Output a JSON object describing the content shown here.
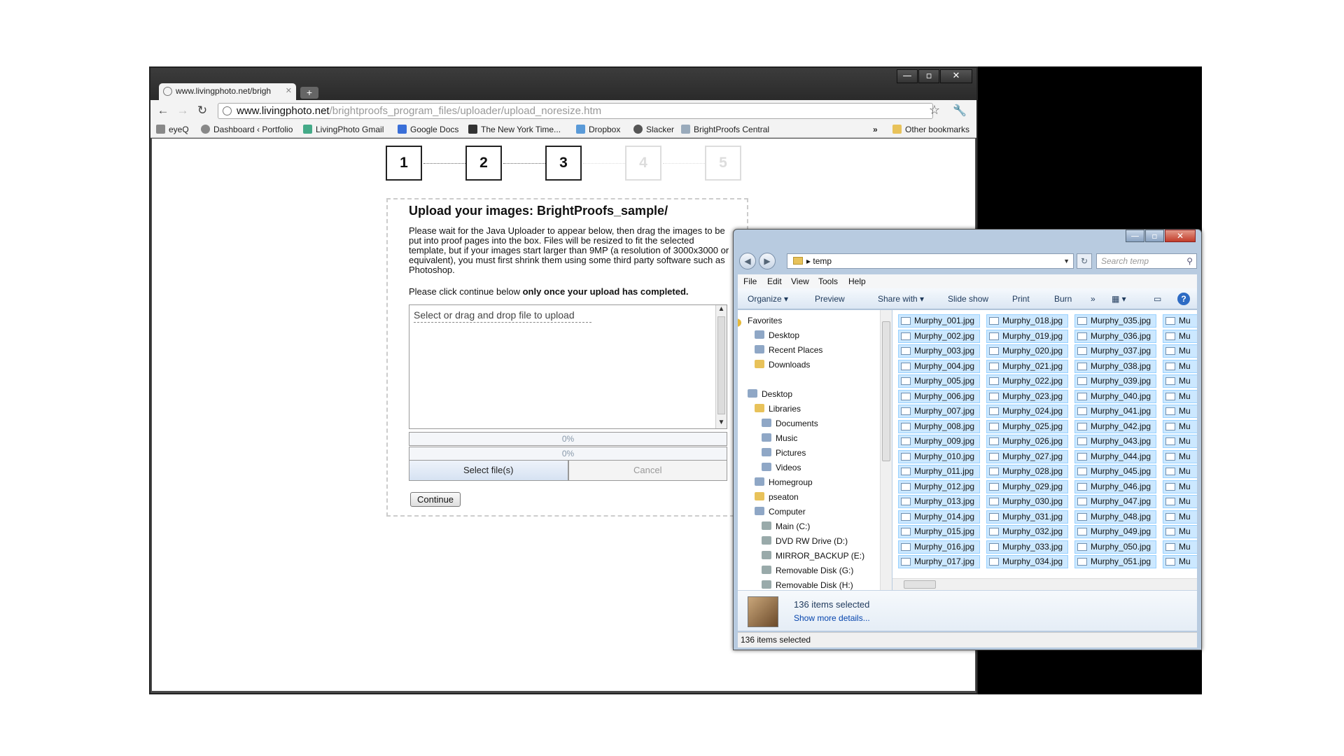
{
  "browser": {
    "tab_title": "www.livingphoto.net/brigh",
    "url_host": "www.livingphoto.net",
    "url_path": "/brightproofs_program_files/uploader/upload_noresize.htm",
    "bookmarks": [
      "eyeQ",
      "Dashboard ‹ Portfolio",
      "LivingPhoto Gmail",
      "Google Docs",
      "The New York Time...",
      "Dropbox",
      "Slacker",
      "BrightProofs Central"
    ],
    "overflow": "»",
    "other_bookmarks": "Other bookmarks"
  },
  "steps": [
    "1",
    "2",
    "3",
    "4",
    "5"
  ],
  "upload": {
    "title": "Upload your images: BrightProofs_sample/",
    "description": "Please wait for the Java Uploader to appear below, then drag the images to be put into proof pages into the box. Files will be resized to fit the selected template, but if your images start larger than 9MP (a resolution of 3000x3000 or equivalent), you must first shrink them using some third party software such as Photoshop.",
    "note_prefix": "Please click continue below ",
    "note_bold": "only once your upload has completed.",
    "drop_text": "Select or drag and drop file to upload",
    "progress1": "0%",
    "progress2": "0%",
    "select_button": "Select file(s)",
    "cancel_button": "Cancel",
    "continue_button": "Continue"
  },
  "explorer": {
    "path": "temp",
    "search_placeholder": "Search temp",
    "menu": [
      "File",
      "Edit",
      "View",
      "Tools",
      "Help"
    ],
    "commands": [
      "Organize ▾",
      "Preview",
      "Share with ▾",
      "Slide show",
      "Print",
      "Burn",
      "»"
    ],
    "nav_items": [
      {
        "label": "Favorites",
        "icon": "star"
      },
      {
        "label": "Desktop",
        "icon": "desktop"
      },
      {
        "label": "Recent Places",
        "icon": "recent"
      },
      {
        "label": "Downloads",
        "icon": "folder"
      },
      {
        "label": "Desktop",
        "icon": "desktop"
      },
      {
        "label": "Libraries",
        "icon": "folder"
      },
      {
        "label": "Documents",
        "icon": "doc"
      },
      {
        "label": "Music",
        "icon": "music"
      },
      {
        "label": "Pictures",
        "icon": "pictures"
      },
      {
        "label": "Videos",
        "icon": "video"
      },
      {
        "label": "Homegroup",
        "icon": "homegroup"
      },
      {
        "label": "pseaton",
        "icon": "folder"
      },
      {
        "label": "Computer",
        "icon": "computer"
      },
      {
        "label": "Main (C:)",
        "icon": "drive"
      },
      {
        "label": "DVD RW Drive (D:)",
        "icon": "drive"
      },
      {
        "label": "MIRROR_BACKUP (E:)",
        "icon": "drive"
      },
      {
        "label": "Removable Disk (G:)",
        "icon": "drive"
      },
      {
        "label": "Removable Disk (H:)",
        "icon": "drive"
      }
    ],
    "files": [
      [
        "Murphy_001.jpg",
        "Murphy_002.jpg",
        "Murphy_003.jpg",
        "Murphy_004.jpg",
        "Murphy_005.jpg",
        "Murphy_006.jpg",
        "Murphy_007.jpg",
        "Murphy_008.jpg",
        "Murphy_009.jpg",
        "Murphy_010.jpg",
        "Murphy_011.jpg",
        "Murphy_012.jpg",
        "Murphy_013.jpg",
        "Murphy_014.jpg",
        "Murphy_015.jpg",
        "Murphy_016.jpg",
        "Murphy_017.jpg"
      ],
      [
        "Murphy_018.jpg",
        "Murphy_019.jpg",
        "Murphy_020.jpg",
        "Murphy_021.jpg",
        "Murphy_022.jpg",
        "Murphy_023.jpg",
        "Murphy_024.jpg",
        "Murphy_025.jpg",
        "Murphy_026.jpg",
        "Murphy_027.jpg",
        "Murphy_028.jpg",
        "Murphy_029.jpg",
        "Murphy_030.jpg",
        "Murphy_031.jpg",
        "Murphy_032.jpg",
        "Murphy_033.jpg",
        "Murphy_034.jpg"
      ],
      [
        "Murphy_035.jpg",
        "Murphy_036.jpg",
        "Murphy_037.jpg",
        "Murphy_038.jpg",
        "Murphy_039.jpg",
        "Murphy_040.jpg",
        "Murphy_041.jpg",
        "Murphy_042.jpg",
        "Murphy_043.jpg",
        "Murphy_044.jpg",
        "Murphy_045.jpg",
        "Murphy_046.jpg",
        "Murphy_047.jpg",
        "Murphy_048.jpg",
        "Murphy_049.jpg",
        "Murphy_050.jpg",
        "Murphy_051.jpg"
      ],
      [
        "Mu",
        "Mu",
        "Mu",
        "Mu",
        "Mu",
        "Mu",
        "Mu",
        "Mu",
        "Mu",
        "Mu",
        "Mu",
        "Mu",
        "Mu",
        "Mu",
        "Mu",
        "Mu",
        "Mu"
      ]
    ],
    "selected_count": "136 items selected",
    "show_more": "Show more details...",
    "status": "136 items selected"
  }
}
